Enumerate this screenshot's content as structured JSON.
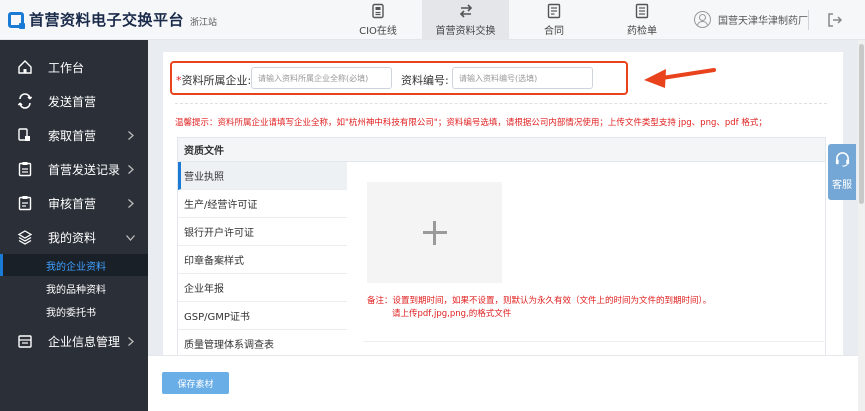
{
  "header": {
    "brand": "首营资料电子交换平台",
    "region": "浙江站",
    "tabs": [
      {
        "label": "CIO在线",
        "icon": "cio-icon"
      },
      {
        "label": "首营资料交换",
        "icon": "exchange-icon"
      },
      {
        "label": "合同",
        "icon": "contract-icon"
      },
      {
        "label": "药检单",
        "icon": "inspection-icon"
      }
    ],
    "active_tab": "首营资料交换",
    "user": "国营天津华津制药厂"
  },
  "sidebar": {
    "items": [
      {
        "label": "工作台",
        "icon": "home-icon"
      },
      {
        "label": "发送首营",
        "icon": "send-icon"
      },
      {
        "label": "索取首营",
        "icon": "request-icon"
      },
      {
        "label": "首营发送记录",
        "icon": "record-icon"
      },
      {
        "label": "审核首营",
        "icon": "audit-icon"
      },
      {
        "label": "我的资料",
        "icon": "layers-icon"
      },
      {
        "label": "企业信息管理",
        "icon": "company-icon"
      }
    ],
    "sub_items": [
      {
        "label": "我的企业资料",
        "active": true
      },
      {
        "label": "我的品种资料",
        "active": false
      },
      {
        "label": "我的委托书",
        "active": false
      }
    ]
  },
  "form": {
    "company_label": "资料所属企业:",
    "company_placeholder": "请输入资料所属企业全称(必填)",
    "code_label": "资料编号:",
    "code_placeholder": "请输入资料编号(选填)",
    "required_mark": "*"
  },
  "tip": "温馨提示：资料所属企业请填写企业全称，如\"杭州神中科技有限公司\"；资料编号选填，请根据公司内部情况使用；上传文件类型支持 jpg、png、pdf 格式；",
  "docs": {
    "header": "资质文件",
    "items": [
      "营业执照",
      "生产/经营许可证",
      "银行开户许可证",
      "印章备案样式",
      "企业年报",
      "GSP/GMP证书",
      "质量管理体系调查表"
    ],
    "active": "营业执照",
    "note_line1": "备注：设置到期时间，如果不设置，则默认为永久有效（文件上的时间为文件的到期时间）。",
    "note_line2": "请上传pdf,jpg,png,的格式文件"
  },
  "support_label": "客服",
  "footer": {
    "save_label": "保存素材"
  },
  "colors": {
    "accent": "#1a7bd6",
    "sidebar_bg": "#2b3038",
    "highlight_box": "#e8431d",
    "warning_text": "#e02020",
    "save_button": "#6aaee8"
  }
}
